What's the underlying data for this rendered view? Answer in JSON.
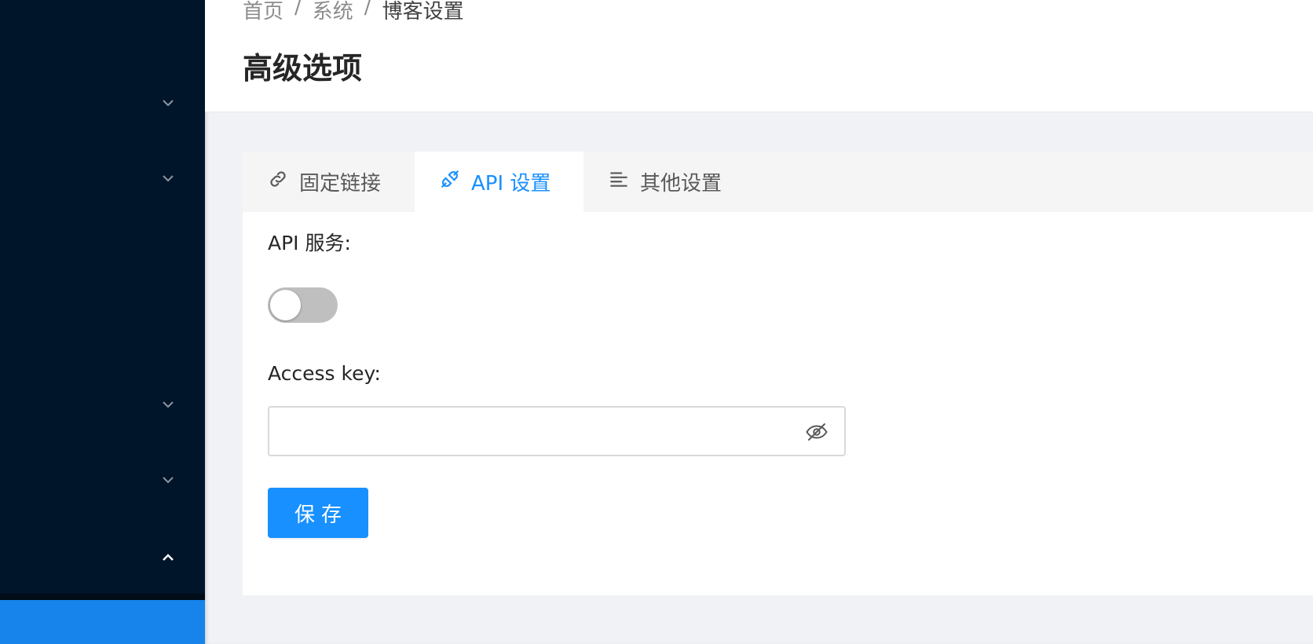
{
  "breadcrumb": [
    "首页",
    "系统",
    "博客设置"
  ],
  "breadcrumb_separator": "/",
  "page_title": "高级选项",
  "tabs": [
    {
      "label": "固定链接",
      "icon": "link-icon",
      "active": false
    },
    {
      "label": "API 设置",
      "icon": "api-icon",
      "active": true
    },
    {
      "label": "其他设置",
      "icon": "align-left-icon",
      "active": false
    }
  ],
  "form": {
    "api_service_label": "API 服务:",
    "api_service_enabled": false,
    "access_key_label": "Access key:",
    "access_key_value": "",
    "access_key_placeholder": "",
    "save_label": "保存"
  },
  "colors": {
    "sidebar_bg": "#001529",
    "accent": "#1890ff",
    "switch_off": "#bfbfbf"
  }
}
